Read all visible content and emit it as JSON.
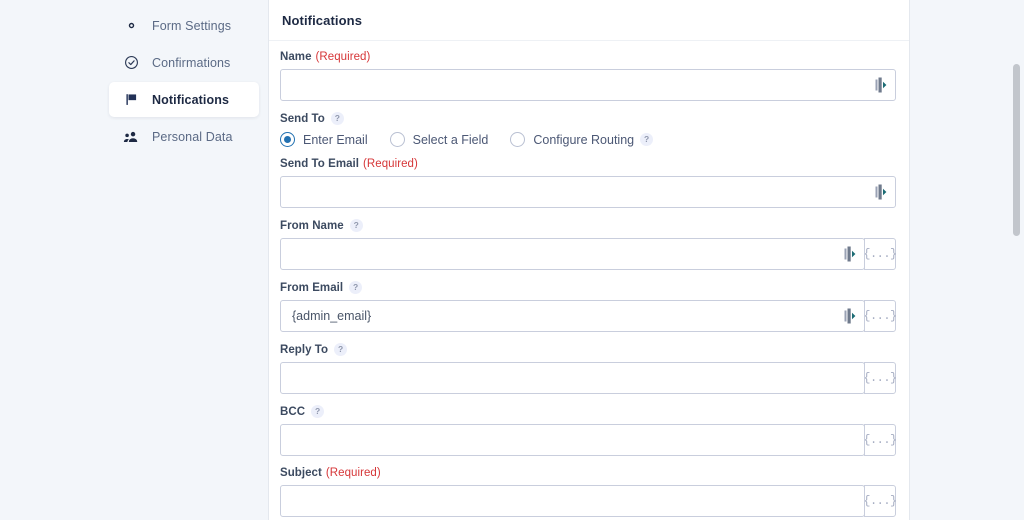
{
  "colors": {
    "page_background": "#f3f6fa",
    "panel_background": "#ffffff",
    "accent_blue": "#2271b1",
    "required_red": "#d63638",
    "nav_icon_navy": "#1d2943",
    "input_border": "#c9cedd"
  },
  "sidebar": {
    "items": [
      {
        "label": "Form Settings",
        "icon": "gear-icon",
        "active": false
      },
      {
        "label": "Confirmations",
        "icon": "check-circle-icon",
        "active": false
      },
      {
        "label": "Notifications",
        "icon": "flag-icon",
        "active": true
      },
      {
        "label": "Personal Data",
        "icon": "users-icon",
        "active": false
      }
    ]
  },
  "panel": {
    "title": "Notifications"
  },
  "fields": {
    "name": {
      "label": "Name",
      "required_text": "(Required)",
      "value": "",
      "placeholder": "",
      "inline_icon": "smart-tag-inline-icon"
    },
    "send_to": {
      "label": "Send To",
      "help": "?",
      "options": [
        {
          "label": "Enter Email",
          "selected": true,
          "help": ""
        },
        {
          "label": "Select a Field",
          "selected": false,
          "help": ""
        },
        {
          "label": "Configure Routing",
          "selected": false,
          "help": "?"
        }
      ]
    },
    "send_to_email": {
      "label": "Send To Email",
      "required_text": "(Required)",
      "value": "",
      "placeholder": "",
      "inline_icon": "smart-tag-inline-icon"
    },
    "from_name": {
      "label": "From Name",
      "help": "?",
      "value": "",
      "placeholder": "",
      "inline_icon": "smart-tag-inline-icon",
      "tag_button": "{...}"
    },
    "from_email": {
      "label": "From Email",
      "help": "?",
      "value": "{admin_email}",
      "placeholder": "",
      "inline_icon": "smart-tag-inline-icon",
      "tag_button": "{...}"
    },
    "reply_to": {
      "label": "Reply To",
      "help": "?",
      "value": "",
      "placeholder": "",
      "tag_button": "{...}"
    },
    "bcc": {
      "label": "BCC",
      "help": "?",
      "value": "",
      "placeholder": "",
      "tag_button": "{...}"
    },
    "subject": {
      "label": "Subject",
      "required_text": "(Required)",
      "value": "",
      "placeholder": "",
      "tag_button": "{...}"
    }
  }
}
